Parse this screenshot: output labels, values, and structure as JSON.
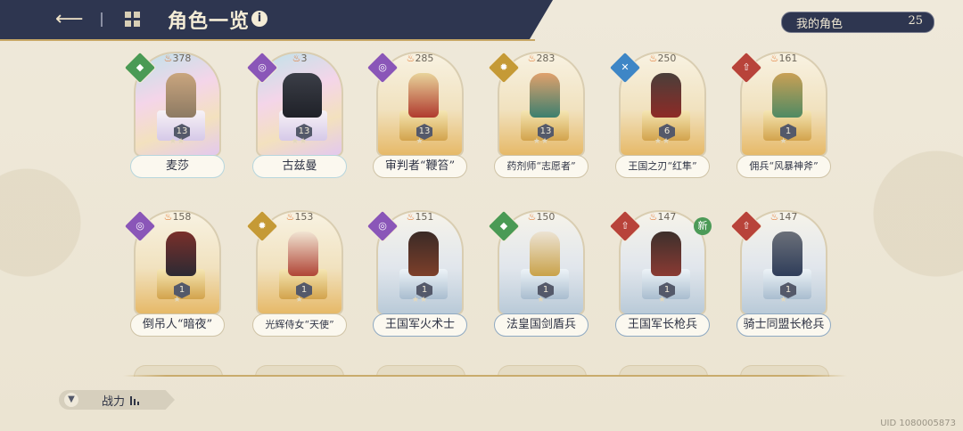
{
  "header": {
    "back_icon": "back-arrow-icon",
    "grid_icon": "grid-icon",
    "title": "角色一览",
    "info_icon": "i"
  },
  "my_characters": {
    "label": "我的角色",
    "count": "25"
  },
  "row1": [
    {
      "name": "麦莎",
      "power": "378",
      "level": "13",
      "class_color": "#4a9a55",
      "frame": "rainbow"
    },
    {
      "name": "古兹曼",
      "power": "3",
      "level": "13",
      "class_color": "#8a56b8",
      "frame": "rainbow"
    },
    {
      "name": "审判者“鞭笞”",
      "power": "285",
      "level": "13",
      "class_color": "#8a56b8",
      "frame": "gold"
    },
    {
      "name": "药剂师“志愿者”",
      "power": "283",
      "level": "13",
      "class_color": "#c59a36",
      "frame": "gold"
    },
    {
      "name": "王国之刃“红隼”",
      "power": "250",
      "level": "6",
      "class_color": "#3e86c6",
      "frame": "gold"
    },
    {
      "name": "佣兵“风暴神斧”",
      "power": "161",
      "level": "1",
      "class_color": "#b8433a",
      "frame": "gold"
    }
  ],
  "row2": [
    {
      "name": "倒吊人“暗夜”",
      "power": "158",
      "level": "1",
      "class_color": "#8a56b8",
      "frame": "gold"
    },
    {
      "name": "光辉侍女“天使”",
      "power": "153",
      "level": "1",
      "class_color": "#c59a36",
      "frame": "gold"
    },
    {
      "name": "王国军火术士",
      "power": "151",
      "level": "1",
      "class_color": "#8a56b8",
      "frame": "blue"
    },
    {
      "name": "法皇国剑盾兵",
      "power": "150",
      "level": "1",
      "class_color": "#4a9a55",
      "frame": "blue"
    },
    {
      "name": "王国军长枪兵",
      "power": "147",
      "level": "1",
      "class_color": "#b8433a",
      "frame": "blue",
      "new": "新"
    },
    {
      "name": "骑士同盟长枪兵",
      "power": "147",
      "level": "1",
      "class_color": "#b8433a",
      "frame": "blue"
    }
  ],
  "sort": {
    "label": "战力",
    "icon": "sort-icon"
  },
  "uid": "UID 1080005873"
}
